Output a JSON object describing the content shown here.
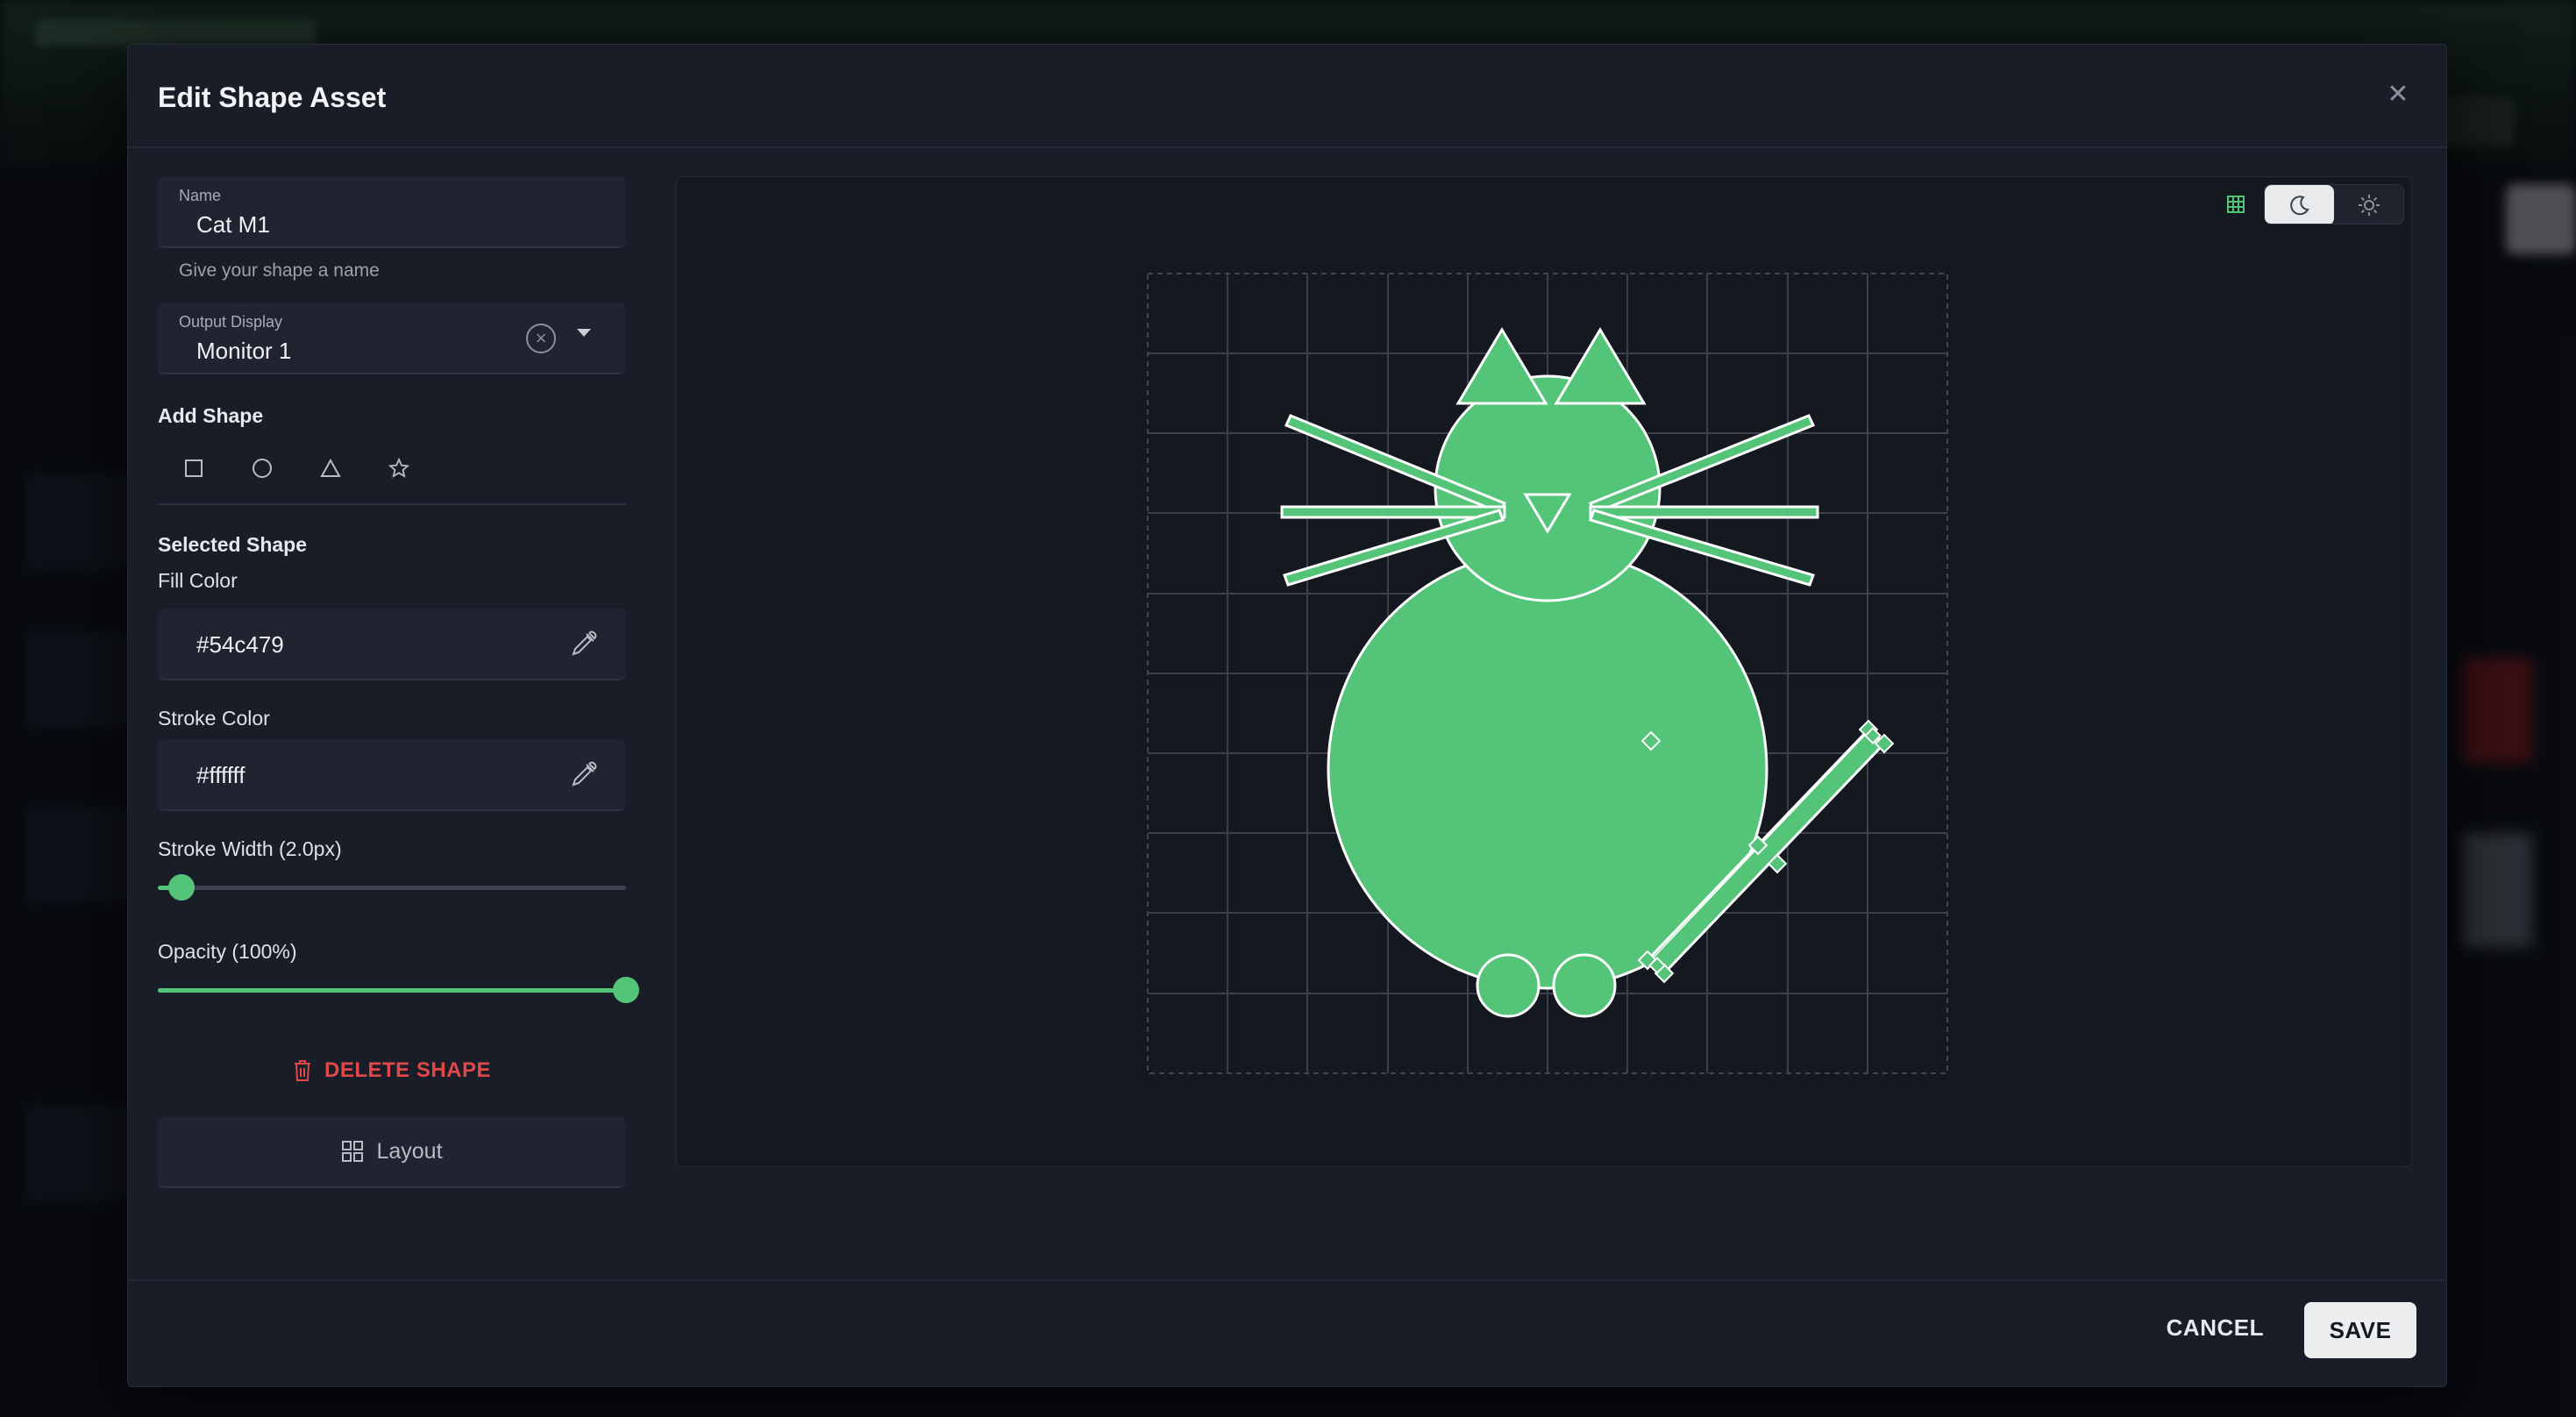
{
  "modal": {
    "title": "Edit Shape Asset",
    "close_icon": "close-icon"
  },
  "name_field": {
    "label": "Name",
    "value": "Cat M1",
    "helper": "Give your shape a name"
  },
  "output_display": {
    "label": "Output Display",
    "value": "Monitor 1"
  },
  "add_shape": {
    "title": "Add Shape",
    "tools": [
      "square-icon",
      "circle-icon",
      "triangle-icon",
      "star-icon"
    ]
  },
  "selected_shape": {
    "title": "Selected Shape",
    "fill_label": "Fill Color",
    "fill_value": "#54c479",
    "stroke_label": "Stroke Color",
    "stroke_value": "#ffffff",
    "stroke_width_label": "Stroke Width (2.0px)",
    "stroke_width_fraction": 0.05,
    "opacity_label": "Opacity (100%)",
    "opacity_fraction": 1.0
  },
  "actions": {
    "delete_label": "DELETE SHAPE",
    "layout_label": "Layout"
  },
  "footer": {
    "cancel_label": "CANCEL",
    "save_label": "SAVE"
  },
  "colors": {
    "accent": "#54c479",
    "danger": "#e14848"
  }
}
